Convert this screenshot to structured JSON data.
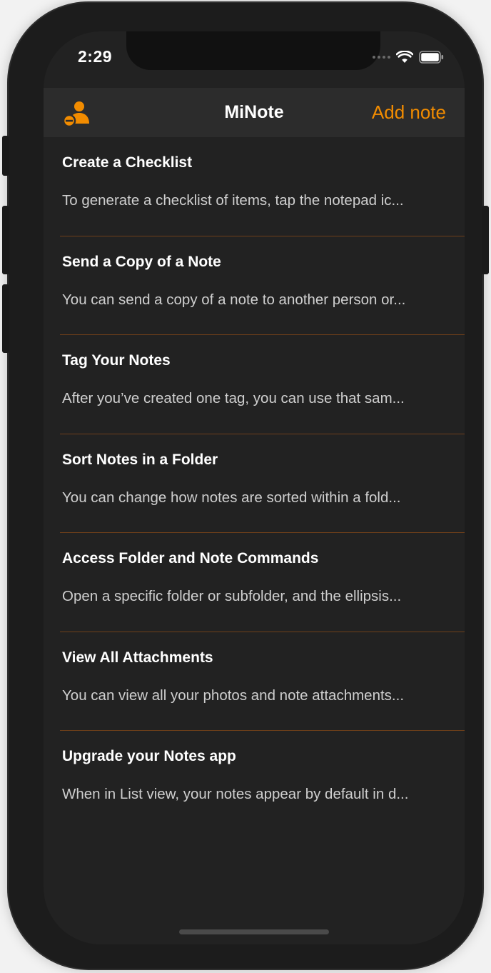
{
  "status_bar": {
    "time": "2:29",
    "icons": [
      "cellular-signal-icon",
      "wifi-icon",
      "battery-icon"
    ]
  },
  "navbar": {
    "left_icon": "profile-icon",
    "title": "MiNote",
    "add_label": "Add note"
  },
  "colors": {
    "accent": "#f28c00",
    "background": "#222222",
    "navbar": "#2c2c2c",
    "divider": "#6e3f1a",
    "title_text": "#ffffff",
    "preview_text": "#cfcfcf"
  },
  "notes": [
    {
      "title": "Create a Checklist",
      "preview": "To generate a checklist of items, tap the notepad ic..."
    },
    {
      "title": "Send a Copy of a Note",
      "preview": "You can send a copy of a note to another person or..."
    },
    {
      "title": "Tag Your Notes",
      "preview": "After you’ve created one tag, you can use that sam..."
    },
    {
      "title": "Sort Notes in a Folder",
      "preview": "You can change how notes are sorted within a fold..."
    },
    {
      "title": "Access Folder and Note Commands",
      "preview": "Open a specific folder or subfolder, and the ellipsis..."
    },
    {
      "title": "View All Attachments",
      "preview": "You can view all your photos and note attachments..."
    },
    {
      "title": "Upgrade your Notes app",
      "preview": "When in List view, your notes appear by default in d..."
    }
  ]
}
